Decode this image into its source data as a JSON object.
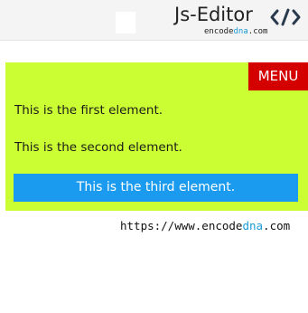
{
  "header": {
    "brand_title": "Js-Editor",
    "brand_sub_prefix": "encode",
    "brand_sub_accent": "dna",
    "brand_sub_suffix": ".com",
    "code_icon": "code-brackets-icon"
  },
  "panel": {
    "menu_label": "MENU",
    "elements": [
      "This is the first element.",
      "This is the second element.",
      "This is the third element."
    ]
  },
  "footer": {
    "url_prefix": "https://www.encode",
    "url_accent": "dna",
    "url_suffix": ".com"
  },
  "colors": {
    "panel_bg": "#ccff33",
    "menu_bg": "#d40000",
    "third_bg": "#1a9bef",
    "accent": "#1a9bd7"
  }
}
